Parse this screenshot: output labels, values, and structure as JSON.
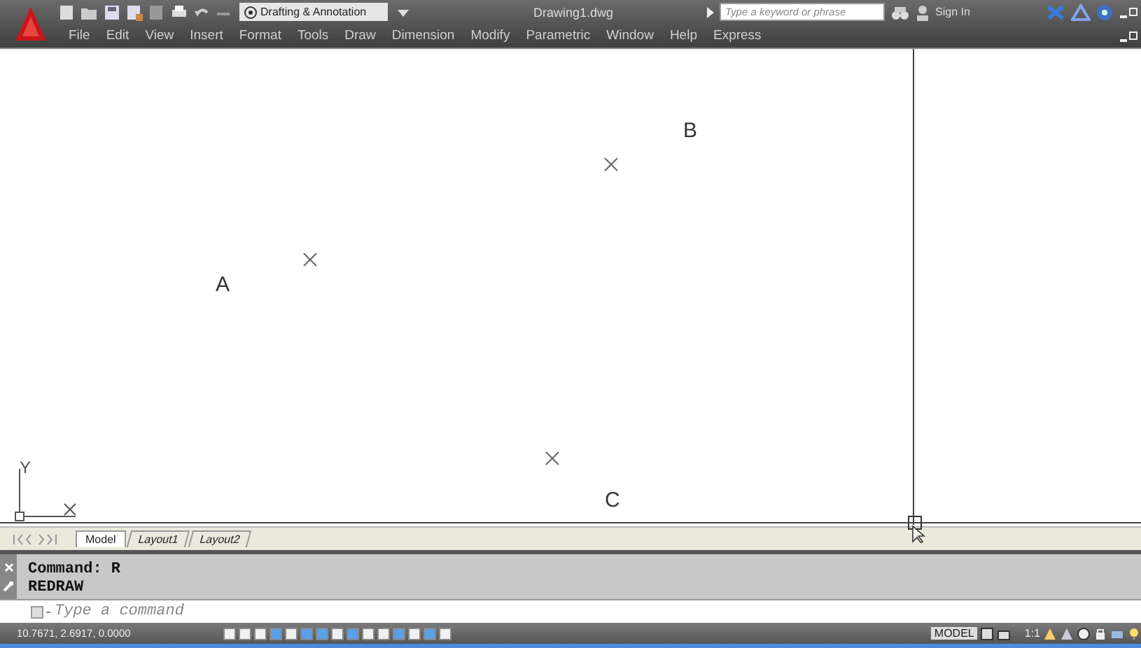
{
  "title_bar": {
    "workspace": "Drafting & Annotation",
    "document_title": "Drawing1.dwg",
    "search": {
      "placeholder": "Type a keyword or phrase"
    },
    "sign_in": "Sign In"
  },
  "menu": [
    "File",
    "Edit",
    "View",
    "Insert",
    "Format",
    "Tools",
    "Draw",
    "Dimension",
    "Modify",
    "Parametric",
    "Window",
    "Help",
    "Express"
  ],
  "drawing": {
    "points": [
      {
        "label": "B"
      },
      {
        "label": "A"
      },
      {
        "label": "C"
      }
    ],
    "ucs": {
      "y_label": "Y"
    }
  },
  "layout_tabs": [
    {
      "label": "Model",
      "selected": true
    },
    {
      "label": "Layout1",
      "selected": false
    },
    {
      "label": "Layout2",
      "selected": false
    }
  ],
  "command_history": [
    "Command:  R",
    "REDRAW"
  ],
  "command_input": {
    "placeholder": "Type a command"
  },
  "status_bar": {
    "coordinates": "10.7671, 2.6917, 0.0000",
    "toggles": [
      {
        "on": false
      },
      {
        "on": false
      },
      {
        "on": false
      },
      {
        "on": true
      },
      {
        "on": false
      },
      {
        "on": true
      },
      {
        "on": true
      },
      {
        "on": false
      },
      {
        "on": true
      },
      {
        "on": false
      },
      {
        "on": false
      },
      {
        "on": true
      },
      {
        "on": false
      },
      {
        "on": true
      },
      {
        "on": false
      }
    ],
    "space": "MODEL",
    "annotation_scale": "1:1"
  }
}
